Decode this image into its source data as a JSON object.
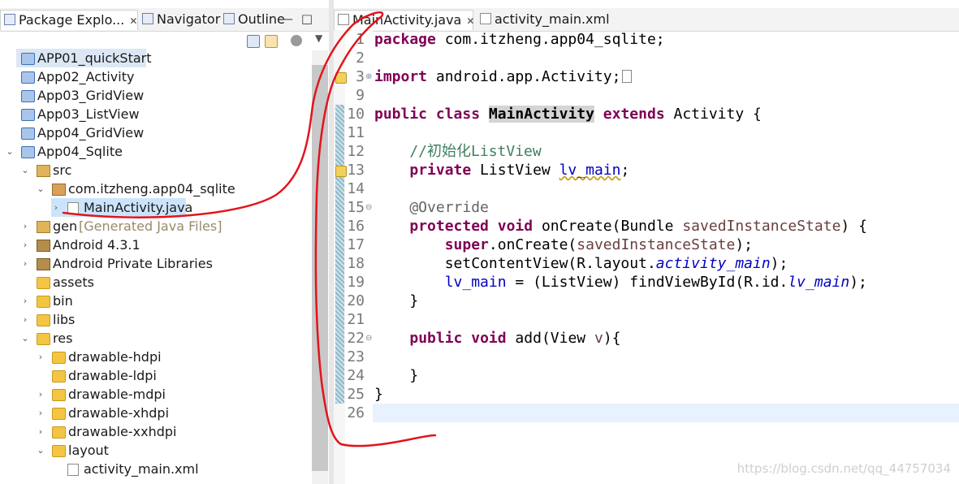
{
  "left_panel": {
    "tabs": [
      {
        "label": "Package Explo...",
        "close": "✕"
      },
      {
        "label": "Navigator"
      },
      {
        "label": "Outline"
      }
    ],
    "tree": [
      {
        "label": "APP01_quickStart",
        "icon": "project-icon"
      },
      {
        "label": "App02_Activity",
        "icon": "project-icon"
      },
      {
        "label": "App03_GridView",
        "icon": "project-icon"
      },
      {
        "label": "App03_ListView",
        "icon": "project-icon"
      },
      {
        "label": "App04_GridView",
        "icon": "project-icon"
      },
      {
        "label": "App04_Sqlite",
        "icon": "android-project-icon"
      },
      {
        "label": "src",
        "icon": "source-folder-icon"
      },
      {
        "label": "com.itzheng.app04_sqlite",
        "icon": "package-icon"
      },
      {
        "label": "MainActivity.java",
        "icon": "java-file-icon"
      },
      {
        "label": "gen",
        "suffix": "[Generated Java Files]",
        "icon": "source-folder-icon"
      },
      {
        "label": "Android 4.3.1",
        "icon": "library-icon"
      },
      {
        "label": "Android Private Libraries",
        "icon": "library-icon"
      },
      {
        "label": "assets",
        "icon": "folder-icon"
      },
      {
        "label": "bin",
        "icon": "folder-icon"
      },
      {
        "label": "libs",
        "icon": "folder-icon"
      },
      {
        "label": "res",
        "icon": "folder-icon"
      },
      {
        "label": "drawable-hdpi",
        "icon": "folder-icon"
      },
      {
        "label": "drawable-ldpi",
        "icon": "folder-icon"
      },
      {
        "label": "drawable-mdpi",
        "icon": "folder-icon"
      },
      {
        "label": "drawable-xhdpi",
        "icon": "folder-icon"
      },
      {
        "label": "drawable-xxhdpi",
        "icon": "folder-icon"
      },
      {
        "label": "layout",
        "icon": "folder-icon"
      },
      {
        "label": "activity_main.xml",
        "icon": "xml-file-icon"
      }
    ]
  },
  "editor": {
    "tabs": [
      {
        "label": "MainActivity.java",
        "close": "✕"
      },
      {
        "label": "activity_main.xml"
      }
    ],
    "lines": [
      {
        "num": "1"
      },
      {
        "num": "2"
      },
      {
        "num": "3"
      },
      {
        "num": "9"
      },
      {
        "num": "10"
      },
      {
        "num": "11"
      },
      {
        "num": "12"
      },
      {
        "num": "13"
      },
      {
        "num": "14"
      },
      {
        "num": "15"
      },
      {
        "num": "16"
      },
      {
        "num": "17"
      },
      {
        "num": "18"
      },
      {
        "num": "19"
      },
      {
        "num": "20"
      },
      {
        "num": "21"
      },
      {
        "num": "22"
      },
      {
        "num": "23"
      },
      {
        "num": "24"
      },
      {
        "num": "25"
      },
      {
        "num": "26"
      }
    ],
    "code": {
      "l1": [
        "package",
        " com.itzheng.app04_sqlite;"
      ],
      "l3": [
        "import",
        " android.app.Activity;"
      ],
      "l10": [
        "public",
        " ",
        "class",
        " ",
        "MainActivity",
        " ",
        "extends",
        " Activity {"
      ],
      "l12": "    //初始化ListView",
      "l13": [
        "    ",
        "private",
        " ListView ",
        "lv_main",
        ";"
      ],
      "l15": "    @Override",
      "l16": [
        "    ",
        "protected",
        " ",
        "void",
        " onCreate(Bundle ",
        "savedInstanceState",
        ") {"
      ],
      "l17": [
        "        ",
        "super",
        ".onCreate(",
        "savedInstanceState",
        ");"
      ],
      "l18": [
        "        setContentView(R.layout.",
        "activity_main",
        ");"
      ],
      "l19": [
        "        ",
        "lv_main",
        " = (ListView) findViewById(R.id.",
        "lv_main",
        ");"
      ],
      "l20": "    }",
      "l22": [
        "    ",
        "public",
        " ",
        "void",
        " add(View ",
        "v",
        "){"
      ],
      "l24": "    }",
      "l25": "}"
    }
  },
  "watermark": "https://blog.csdn.net/qq_44757034"
}
